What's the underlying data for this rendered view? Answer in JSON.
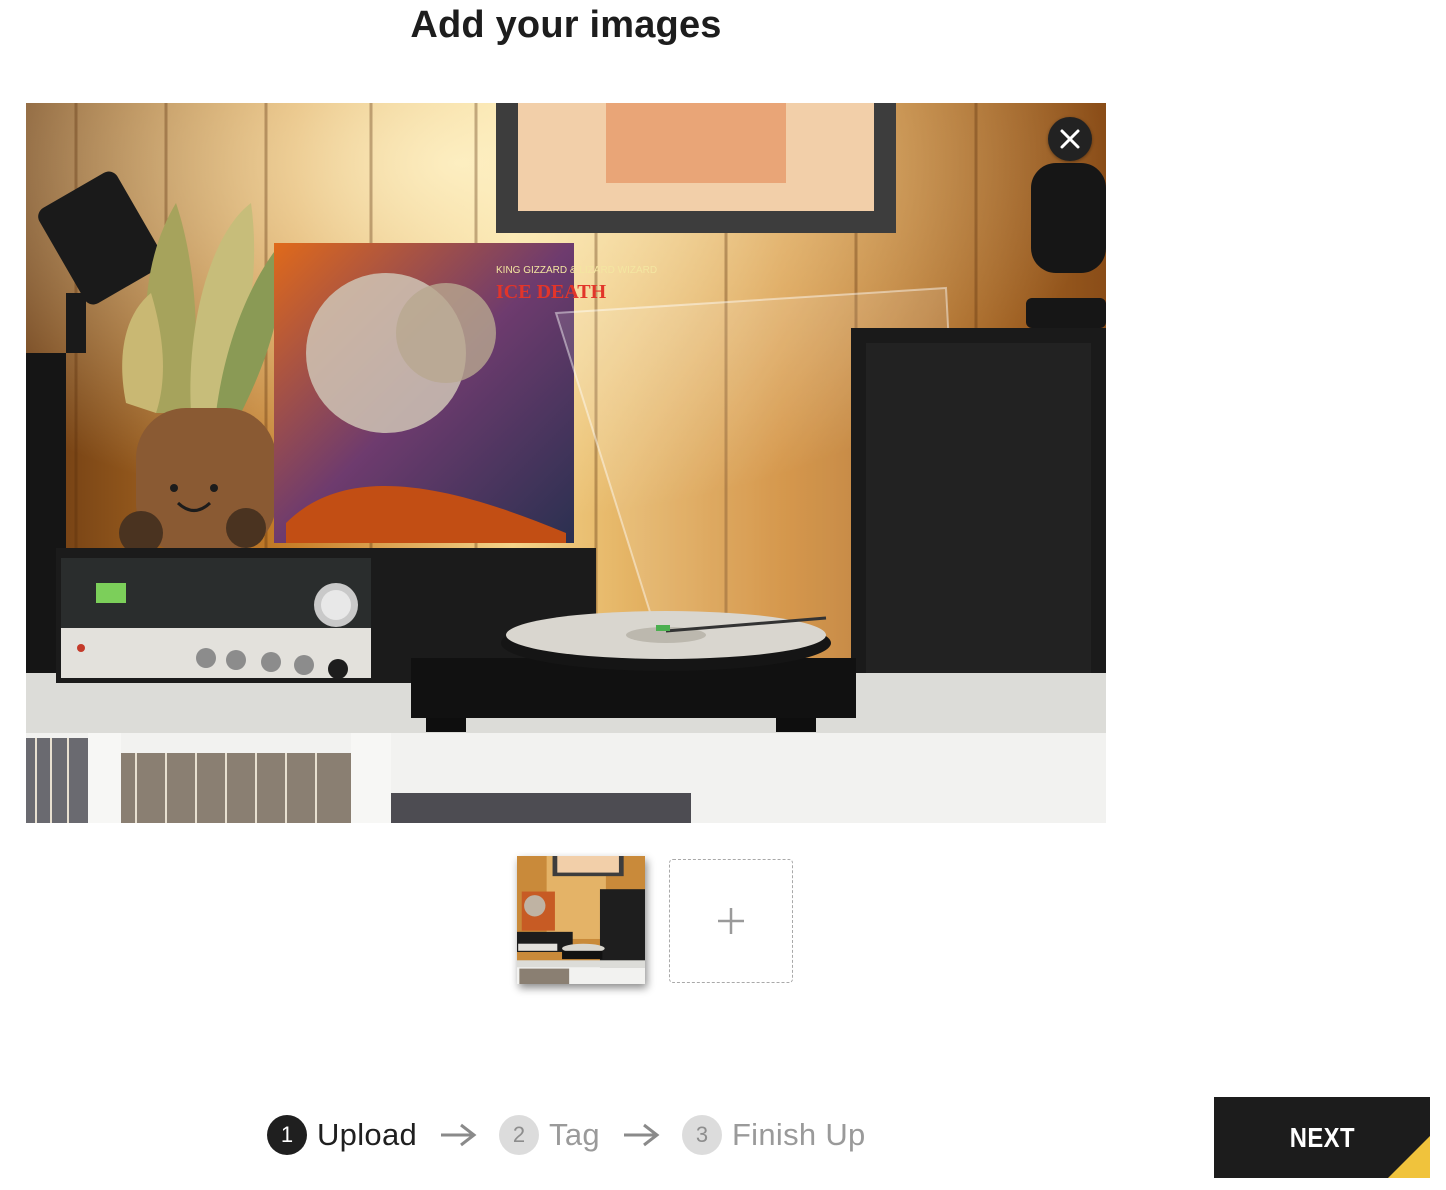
{
  "header": {
    "title": "Add your images"
  },
  "gallery": {
    "remove_icon": "close-icon",
    "thumbnails": [
      {
        "selected": true
      }
    ],
    "add_icon": "plus-icon"
  },
  "steps": [
    {
      "number": "1",
      "label": "Upload",
      "state": "active"
    },
    {
      "number": "2",
      "label": "Tag",
      "state": "inactive"
    },
    {
      "number": "3",
      "label": "Finish Up",
      "state": "inactive"
    }
  ],
  "footer": {
    "next_label": "NEXT"
  },
  "colors": {
    "accent": "#f0c33c",
    "button_bg": "#1c1c1c",
    "active_step": "#1f1f1f",
    "inactive_step": "#dcdcdc"
  }
}
